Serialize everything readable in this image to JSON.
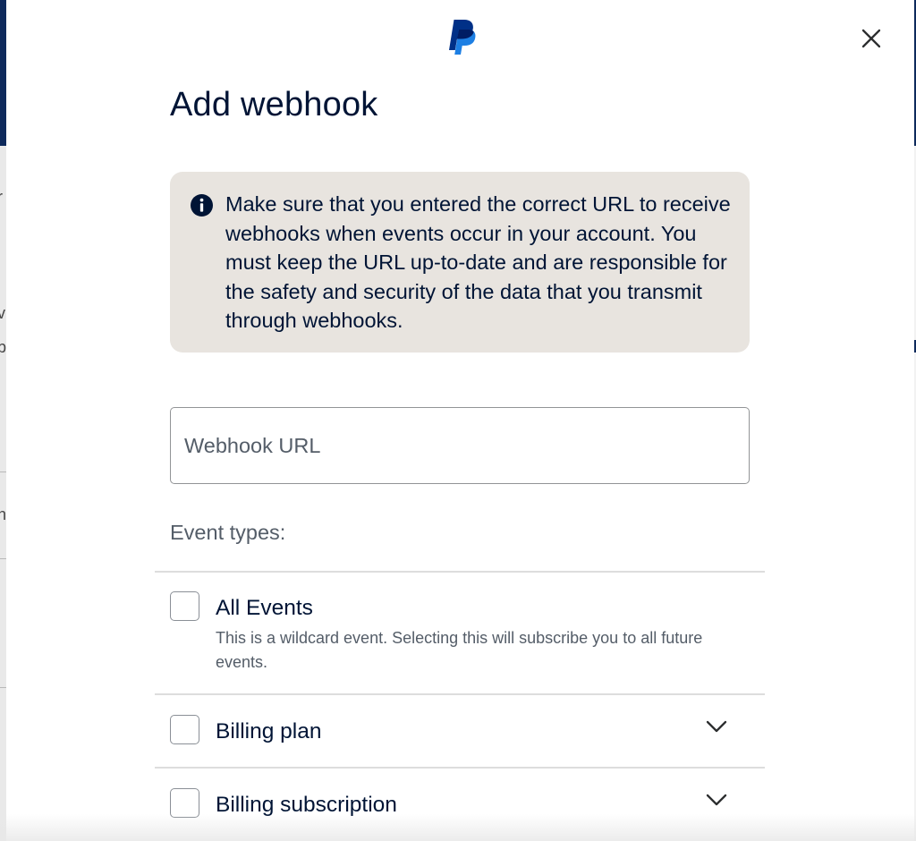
{
  "modal": {
    "logo": "paypal-logo",
    "close_icon": "close-icon",
    "title": "Add webhook"
  },
  "info": {
    "icon": "info-icon",
    "message": "Make sure that you entered the correct URL to receive webhooks when events occur in your account. You must keep the URL up-to-date and are responsible for the safety and security of the data that you transmit through webhooks."
  },
  "url_field": {
    "placeholder": "Webhook URL",
    "value": ""
  },
  "event_types": {
    "label": "Event types:",
    "items": [
      {
        "label": "All Events",
        "description": "This is a wildcard event. Selecting this will subscribe you to all future events.",
        "checked": false,
        "expandable": false
      },
      {
        "label": "Billing plan",
        "checked": false,
        "expandable": true,
        "icon": "chevron-down-icon"
      },
      {
        "label": "Billing subscription",
        "checked": false,
        "expandable": true,
        "icon": "chevron-down-icon"
      }
    ]
  },
  "colors": {
    "text": "#001435",
    "muted_text": "#545d68",
    "info_bg": "#e8e4df",
    "brand_dark_blue": "#003087",
    "brand_light_blue": "#1d7fe3",
    "border": "#929496"
  }
}
